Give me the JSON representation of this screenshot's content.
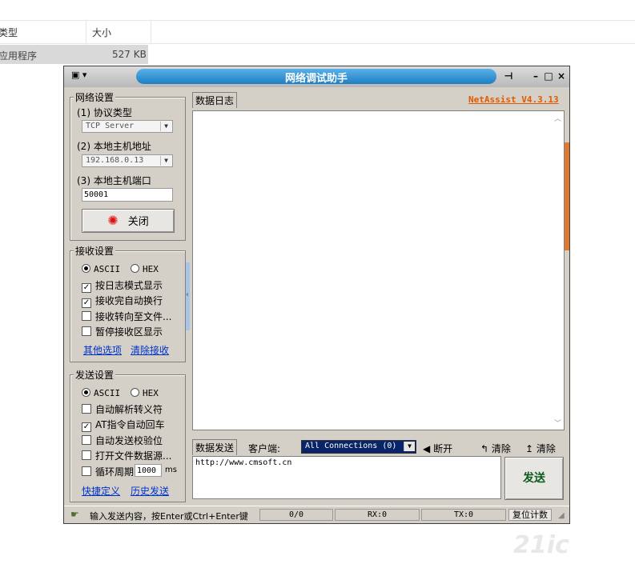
{
  "explorer": {
    "col_type": "类型",
    "col_size": "大小",
    "row_type": "应用程序",
    "row_size": "527 KB"
  },
  "window": {
    "title": "网络调试助手",
    "sysmenu": "▾",
    "pin": "⊣",
    "minimize": "–",
    "maximize": "□",
    "close": "×"
  },
  "net": {
    "title": "网络设置",
    "protocol_label": "(1) 协议类型",
    "protocol_value": "TCP Server",
    "host_label": "(2) 本地主机地址",
    "host_value": "192.168.0.13",
    "port_label": "(3) 本地主机端口",
    "port_value": "50001",
    "close_label": "关闭"
  },
  "recv": {
    "title": "接收设置",
    "ascii": "ASCII",
    "hex": "HEX",
    "options": [
      {
        "label": "按日志模式显示",
        "checked": true
      },
      {
        "label": "接收完自动换行",
        "checked": true
      },
      {
        "label": "接收转向至文件...",
        "checked": false
      },
      {
        "label": "暂停接收区显示",
        "checked": false
      }
    ],
    "link_more": "其他选项",
    "link_clear": "清除接收"
  },
  "send": {
    "title": "发送设置",
    "ascii": "ASCII",
    "hex": "HEX",
    "options": [
      {
        "label": "自动解析转义符",
        "checked": false
      },
      {
        "label": "AT指令自动回车",
        "checked": true
      },
      {
        "label": "自动发送校验位",
        "checked": false
      },
      {
        "label": "打开文件数据源...",
        "checked": false
      },
      {
        "label": "循环周期",
        "checked": false
      }
    ],
    "period_value": "1000",
    "period_unit": "ms",
    "link_shortcut": "快捷定义",
    "link_history": "历史发送"
  },
  "log": {
    "tab": "数据日志",
    "brand": "NetAssist V4.3.13"
  },
  "sendbar": {
    "tab": "数据发送",
    "client_label": "客户端:",
    "client_value": "All Connections (0)",
    "disconnect": "断开",
    "clear1": "清除",
    "clear2": "清除",
    "send_text": "http://www.cmsoft.cn",
    "send_button": "发送"
  },
  "status": {
    "hint": "输入发送内容，按Enter或Ctrl+Enter键",
    "count": "0/0",
    "rx": "RX:0",
    "tx": "TX:0",
    "reset": "复位计数"
  },
  "watermark": "21ic"
}
